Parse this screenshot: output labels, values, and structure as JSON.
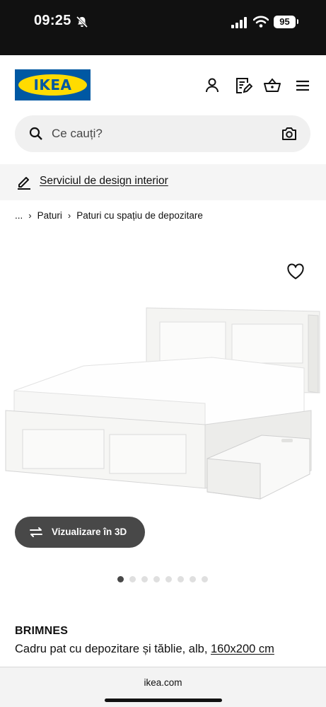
{
  "status_bar": {
    "time": "09:25",
    "battery": "95"
  },
  "header": {
    "logo_text": "IKEA",
    "icons": [
      "user-icon",
      "shopping-list-icon",
      "basket-icon",
      "menu-icon"
    ]
  },
  "search": {
    "placeholder": "Ce cauți?"
  },
  "design_service": {
    "label": "Serviciul de design interior"
  },
  "breadcrumb": {
    "items": [
      "...",
      "Paturi",
      "Paturi cu spațiu de depozitare"
    ]
  },
  "product": {
    "view_3d_label": "Vizualizare în 3D",
    "image_count": 8,
    "active_image": 1,
    "name": "BRIMNES",
    "description": "Cadru pat cu depozitare și tăblie, alb, ",
    "size": "160x200 cm"
  },
  "browser": {
    "url": "ikea.com"
  },
  "colors": {
    "brand_blue": "#0058a3",
    "brand_yellow": "#ffdb00",
    "button_dark": "#484848"
  }
}
